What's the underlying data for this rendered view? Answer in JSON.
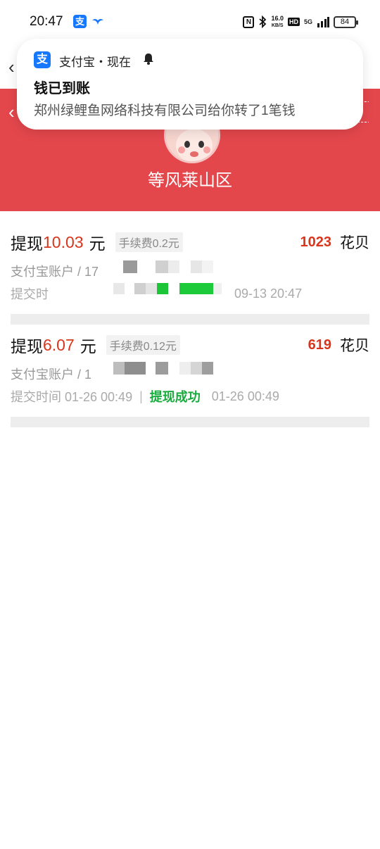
{
  "status_bar": {
    "time": "20:47",
    "app_icon": "支",
    "nfc": "N",
    "speed_value": "16.0",
    "speed_unit": "KB/S",
    "hd": "HD",
    "network": "5G",
    "battery": "84"
  },
  "notification": {
    "app_icon": "支",
    "source": "支付宝・现在",
    "title": "钱已到账",
    "body": "郑州绿鲤鱼网络科技有限公司给你转了1笔钱"
  },
  "header": {
    "username": "等风莱山区",
    "bg_color": "#e3474c"
  },
  "records": [
    {
      "title": "提现",
      "amount": "10.03",
      "unit": "元",
      "fee": "手续费0.2元",
      "points": "1023",
      "points_unit": "花贝",
      "account": "支付宝账户 / 17",
      "time_label": "提交时",
      "status": "",
      "finish_time": "09-13 20:47"
    },
    {
      "title": "提现",
      "amount": "6.07",
      "unit": "元",
      "fee": "手续费0.12元",
      "points": "619",
      "points_unit": "花贝",
      "account": "支付宝账户 / 1",
      "time_label": "提交时间 01-26 00:49",
      "status": "提现成功",
      "finish_time": "01-26 00:49"
    }
  ],
  "colors": {
    "accent_red": "#d9351d",
    "success_green": "#1aab3e",
    "alipay_blue": "#1677ff"
  }
}
